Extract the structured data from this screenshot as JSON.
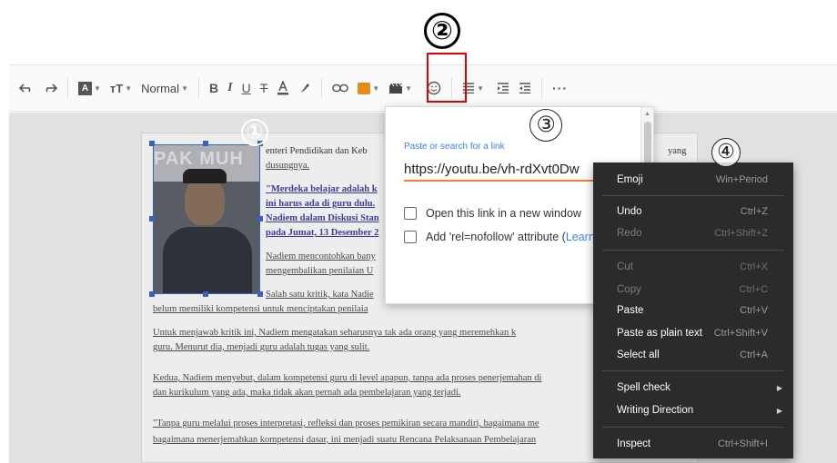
{
  "markers": {
    "m1": "①",
    "m2": "②",
    "m3": "③",
    "m4": "④"
  },
  "toolbar": {
    "paragraph_style": "Normal",
    "items": [
      "undo-icon",
      "redo-icon",
      "text-color-icon",
      "font-size-icon",
      "bold-icon",
      "italic-icon",
      "underline-icon",
      "strikethrough-icon",
      "highlight-icon",
      "link-icon",
      "image-icon",
      "video-icon",
      "emoji-icon",
      "align-icon",
      "indent-icon",
      "outdent-icon",
      "more-icon"
    ],
    "bold": "B",
    "italic": "I",
    "underline": "U",
    "strike": "T",
    "more": "···"
  },
  "document": {
    "photo_banner": "PAK MUH",
    "p1_line1": "enteri Pendidikan dan Keb",
    "p1_line1_end": "yang",
    "p1_line2": "dusungnya.",
    "quote_l1": "\"Merdeka belajar adalah k",
    "quote_l2": "ini harus ada di guru dulu. ",
    "quote_l3": "Nadiem dalam Diskusi Stan",
    "quote_l4": "pada Jumat, 13 Desember 2",
    "p2_l1": "Nadiem mencontohkan bany",
    "p2_l2": "mengembalikan penilaian U",
    "p3_l1": "Salah satu kritik, kata Nadie",
    "p3_l2": "belum memiliki kompetensi untuk menciptakan penilaia",
    "p4_l1": "Untuk menjawab kritik ini, Nadiem mengatakan seharusnya tak ada orang yang meremehkan k",
    "p4_l2": "guru. Menurut dia, menjadi guru adalah tugas yang sulit.",
    "p5_l1": "Kedua, Nadiem menyebut, dalam kompetensi guru di level apapun, tanpa ada proses penerjemahan di",
    "p5_l2": "dan kurikulum yang ada, maka tidak akan pernah ada pembelajaran yang terjadi.",
    "p6_l1": "\"Tanpa guru melalui proses interpretasi, refleksi dan proses pemikiran secara mandiri, bagaimana me",
    "p6_l2": "bagaimana menerjemahkan kompetensi dasar, ini menjadi suatu Rencana Pelaksanaan Pembelajaran"
  },
  "link_popup": {
    "label": "Paste or search for a link",
    "url_value": "https://youtu.be/vh-rdXvt0Dw",
    "new_window_label": "Open this link in a new window",
    "nofollow_label": "Add 'rel=nofollow' attribute (",
    "learn_label": "Learn"
  },
  "context_menu": {
    "items": [
      {
        "label": "Emoji",
        "shortcut": "Win+Period",
        "enabled": true
      },
      {
        "label": "Undo",
        "shortcut": "Ctrl+Z",
        "enabled": true
      },
      {
        "label": "Redo",
        "shortcut": "Ctrl+Shift+Z",
        "enabled": false
      },
      {
        "label": "Cut",
        "shortcut": "Ctrl+X",
        "enabled": false
      },
      {
        "label": "Copy",
        "shortcut": "Ctrl+C",
        "enabled": false
      },
      {
        "label": "Paste",
        "shortcut": "Ctrl+V",
        "enabled": true
      },
      {
        "label": "Paste as plain text",
        "shortcut": "Ctrl+Shift+V",
        "enabled": true
      },
      {
        "label": "Select all",
        "shortcut": "Ctrl+A",
        "enabled": true
      },
      {
        "label": "Spell check",
        "shortcut": "",
        "enabled": true,
        "submenu": true
      },
      {
        "label": "Writing Direction",
        "shortcut": "",
        "enabled": true,
        "submenu": true
      },
      {
        "label": "Inspect",
        "shortcut": "Ctrl+Shift+I",
        "enabled": true
      }
    ]
  },
  "colors": {
    "highlight": "#e00000",
    "accent": "#3b82f6",
    "input_underline": "#f57c3a",
    "menu_bg": "#2b2b2b"
  }
}
